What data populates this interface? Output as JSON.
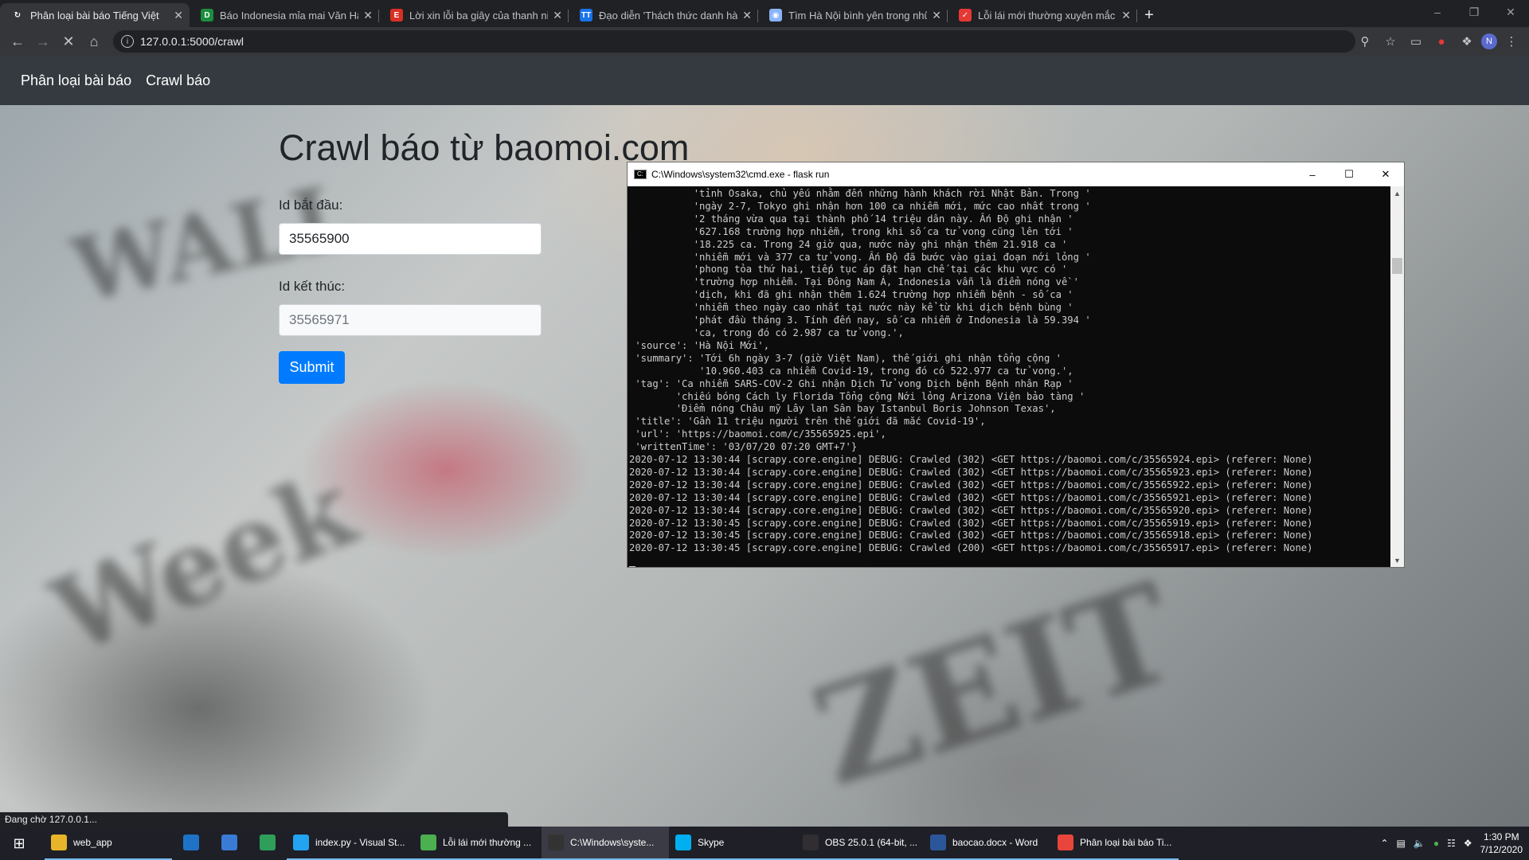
{
  "browser": {
    "tabs": [
      {
        "title": "Phân loại bài báo Tiếng Việt",
        "active": true,
        "icon": "loading-spinner-icon"
      },
      {
        "title": "Báo Indonesia mỉa mai Văn Hậu",
        "icon": "d-favicon-icon"
      },
      {
        "title": "Lời xin lỗi ba giây của thanh niên",
        "icon": "e-favicon-icon"
      },
      {
        "title": "Đạo diễn 'Thách thức danh hài' b",
        "icon": "tt-favicon-icon"
      },
      {
        "title": "Tìm Hà Nội bình yên trong những",
        "icon": "globe-favicon-icon"
      },
      {
        "title": "Lỗi lái mới thường xuyên mắc ph",
        "icon": "check-favicon-icon"
      }
    ],
    "url": "127.0.0.1:5000/crawl",
    "avatar_letter": "N"
  },
  "navbar": {
    "items": [
      "Phân loại bài báo",
      "Crawl báo"
    ]
  },
  "form": {
    "heading": "Crawl báo từ baomoi.com",
    "start_label": "Id bắt đầu:",
    "start_value": "35565900",
    "end_label": "Id kết thúc:",
    "end_value": "35565971",
    "submit": "Submit"
  },
  "cmd": {
    "title": "C:\\Windows\\system32\\cmd.exe - flask  run",
    "lines": [
      "           'tỉnh Osaka, chủ yếu nhằm đến những hành khách rời Nhật Bản. Trong '",
      "           'ngày 2-7, Tokyo ghi nhận hơn 100 ca nhiễm mới, mức cao nhất trong '",
      "           '2 tháng vừa qua tại thành phố 14 triệu dân này. Ấn Độ ghi nhận '",
      "           '627.168 trường hợp nhiễm, trong khi số ca tử vong cũng lên tới '",
      "           '18.225 ca. Trong 24 giờ qua, nước này ghi nhận thêm 21.918 ca '",
      "           'nhiễm mới và 377 ca tử vong. Ấn Độ đã bước vào giai đoạn nới lỏng '",
      "           'phong tỏa thứ hai, tiếp tục áp đặt hạn chế tại các khu vực có '",
      "           'trường hợp nhiễm. Tại Đông Nam Á, Indonesia vẫn là điểm nóng về '",
      "           'dịch, khi đã ghi nhận thêm 1.624 trường hợp nhiễm bệnh - số ca '",
      "           'nhiễm theo ngày cao nhất tại nước này kể từ khi dịch bệnh bùng '",
      "           'phát đầu tháng 3. Tính đến nay, số ca nhiễm ở Indonesia là 59.394 '",
      "           'ca, trong đó có 2.987 ca tử vong.',",
      " 'source': 'Hà Nội Mới',",
      " 'summary': 'Tới 6h ngày 3-7 (giờ Việt Nam), thế giới ghi nhận tổng cộng '",
      "            '10.960.403 ca nhiễm Covid-19, trong đó có 522.977 ca tử vong.',",
      " 'tag': 'Ca nhiễm SARS-COV-2 Ghi nhận Dịch Tử vong Dịch bệnh Bệnh nhân Rạp '",
      "        'chiếu bóng Cách ly Florida Tổng cộng Nới lỏng Arizona Viện bảo tàng '",
      "        'Điểm nóng Châu mỹ Lây lan Sân bay Istanbul Boris Johnson Texas',",
      " 'title': 'Gần 11 triệu người trên thế giới đã mắc Covid-19',",
      " 'url': 'https://baomoi.com/c/35565925.epi',",
      " 'writtenTime': '03/07/20 07:20 GMT+7'}",
      "2020-07-12 13:30:44 [scrapy.core.engine] DEBUG: Crawled (302) <GET https://baomoi.com/c/35565924.epi> (referer: None)",
      "2020-07-12 13:30:44 [scrapy.core.engine] DEBUG: Crawled (302) <GET https://baomoi.com/c/35565923.epi> (referer: None)",
      "2020-07-12 13:30:44 [scrapy.core.engine] DEBUG: Crawled (302) <GET https://baomoi.com/c/35565922.epi> (referer: None)",
      "2020-07-12 13:30:44 [scrapy.core.engine] DEBUG: Crawled (302) <GET https://baomoi.com/c/35565921.epi> (referer: None)",
      "2020-07-12 13:30:44 [scrapy.core.engine] DEBUG: Crawled (302) <GET https://baomoi.com/c/35565920.epi> (referer: None)",
      "2020-07-12 13:30:45 [scrapy.core.engine] DEBUG: Crawled (302) <GET https://baomoi.com/c/35565919.epi> (referer: None)",
      "2020-07-12 13:30:45 [scrapy.core.engine] DEBUG: Crawled (302) <GET https://baomoi.com/c/35565918.epi> (referer: None)",
      "2020-07-12 13:30:45 [scrapy.core.engine] DEBUG: Crawled (200) <GET https://baomoi.com/c/35565917.epi> (referer: None)"
    ]
  },
  "status_text": "Đang chờ 127.0.0.1...",
  "taskbar": {
    "items": [
      {
        "label": "web_app",
        "icon": "folder-icon",
        "color": "#e8b52a"
      },
      {
        "label": "",
        "icon": "mail-icon",
        "color": "#1e73c8"
      },
      {
        "label": "",
        "icon": "store-icon",
        "color": "#3a7bd5"
      },
      {
        "label": "",
        "icon": "edge-icon",
        "color": "#2f9e5a"
      },
      {
        "label": "index.py - Visual St...",
        "icon": "vscode-icon",
        "color": "#23a3f0"
      },
      {
        "label": "Lỗi lái mới thường ...",
        "icon": "chrome-alt-icon",
        "color": "#4caf50"
      },
      {
        "label": "C:\\Windows\\syste...",
        "icon": "cmd-icon",
        "color": "#333333",
        "active": true
      },
      {
        "label": "Skype",
        "icon": "skype-icon",
        "color": "#00aff0"
      },
      {
        "label": "OBS 25.0.1 (64-bit, ...",
        "icon": "obs-icon",
        "color": "#302e31"
      },
      {
        "label": "baocao.docx - Word",
        "icon": "word-icon",
        "color": "#2b579a"
      },
      {
        "label": "Phân loại bài báo Ti...",
        "icon": "chrome-icon",
        "color": "#e8453c"
      }
    ],
    "time": "1:30 PM",
    "date": "7/12/2020"
  }
}
